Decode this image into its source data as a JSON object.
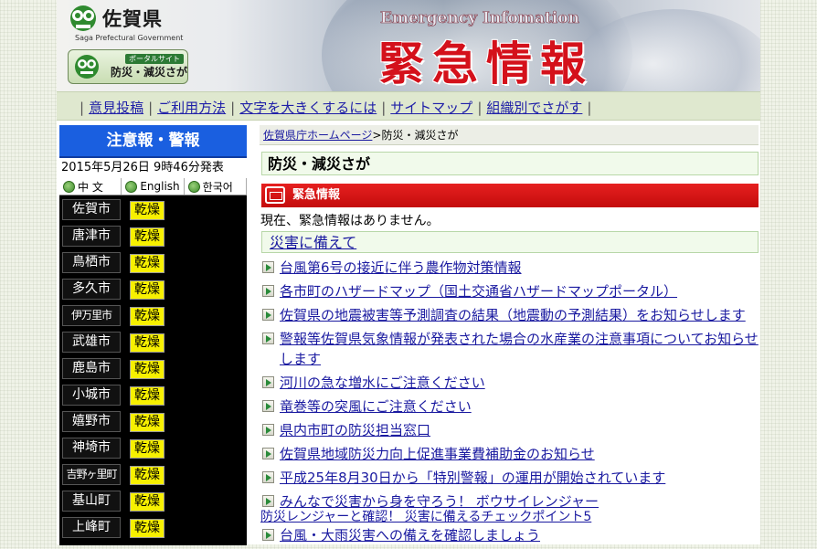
{
  "header": {
    "logo_name": "佐賀県",
    "logo_sub": "Saga Prefectural Government",
    "portal_tag": "ポータルサイト",
    "portal_label": "防災・減災さが",
    "banner_en": "Emergency Infomation",
    "banner_jp": "緊急情報"
  },
  "nav": {
    "items": [
      "意見投稿",
      "ご利用方法",
      "文字を大きくするには",
      "サイトマップ",
      "組織別でさがす"
    ]
  },
  "warnings": {
    "title": "注意報・警報",
    "issued": "2015年5月26日 9時46分発表",
    "languages": [
      "中 文",
      "English",
      "한국어"
    ],
    "cities": [
      {
        "name": "佐賀市",
        "status": "乾燥"
      },
      {
        "name": "唐津市",
        "status": "乾燥"
      },
      {
        "name": "鳥栖市",
        "status": "乾燥"
      },
      {
        "name": "多久市",
        "status": "乾燥"
      },
      {
        "name": "伊万里市",
        "status": "乾燥"
      },
      {
        "name": "武雄市",
        "status": "乾燥"
      },
      {
        "name": "鹿島市",
        "status": "乾燥"
      },
      {
        "name": "小城市",
        "status": "乾燥"
      },
      {
        "name": "嬉野市",
        "status": "乾燥"
      },
      {
        "name": "神埼市",
        "status": "乾燥"
      },
      {
        "name": "吉野ヶ里町",
        "status": "乾燥"
      },
      {
        "name": "基山町",
        "status": "乾燥"
      },
      {
        "name": "上峰町",
        "status": "乾燥"
      }
    ]
  },
  "main": {
    "breadcrumb_home": "佐賀県庁ホームページ",
    "breadcrumb_sep": ">",
    "breadcrumb_current": "防災・減災さが",
    "page_title": "防災・減災さが",
    "emergency_label": "緊急情報",
    "emergency_notice": "現在、緊急情報はありません。",
    "section_title": "災害に備えて",
    "links": [
      "台風第6号の接近に伴う農作物対策情報",
      "各市町のハザードマップ（国土交通省ハザードマップポータル）",
      "佐賀県の地震被害等予測調査の結果（地震動の予測結果）をお知らせします",
      "警報等佐賀県気象情報が発表された場合の水産業の注意事項についてお知らせします",
      "河川の急な増水にご注意ください",
      "竜巻等の突風にご注意ください",
      "県内市町の防災担当窓口",
      "佐賀県地域防災力向上促進事業費補助金のお知らせ",
      "平成25年8月30日から「特別警報」の運用が開始されています",
      "みんなで災害から身を守ろう！ ボウサイレンジャー"
    ],
    "plain_link": "防災レンジャーと確認！ 災害に備えるチェックポイント5",
    "last_link": "台風・大雨災害への備えを確認しましょう"
  },
  "colors": {
    "warning_header": "#1a5fe0",
    "dry_badge": "#f7f000",
    "emergency_bar": "#d41414",
    "link": "#1a1aa0"
  }
}
